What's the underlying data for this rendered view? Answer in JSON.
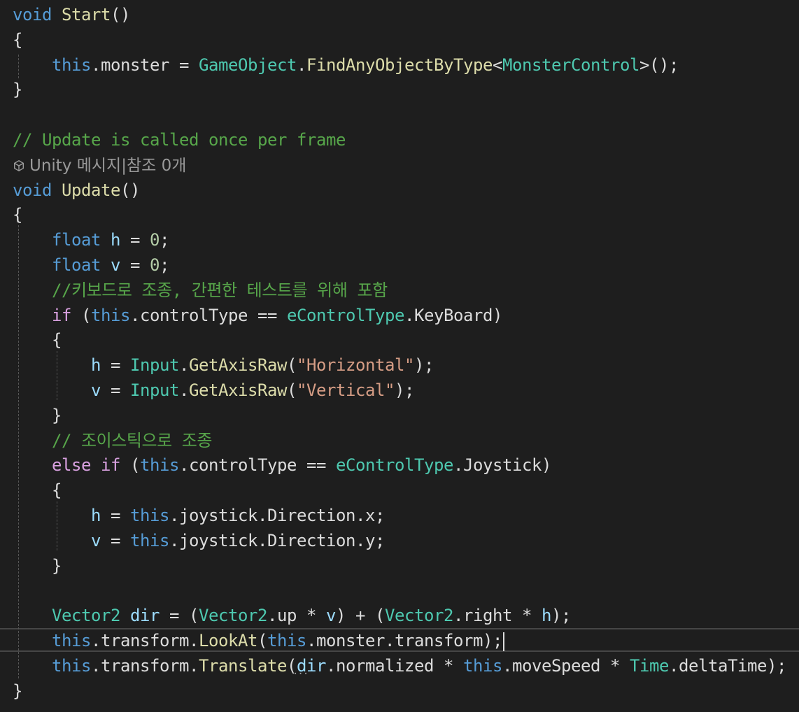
{
  "colors": {
    "background": "#1e1e1e",
    "keyword": "#569cd6",
    "control_keyword": "#d8a0df",
    "method": "#dcdcaa",
    "type": "#4ec9b0",
    "comment": "#57a64a",
    "string": "#d69d85",
    "number": "#b5cea8",
    "local": "#9cdcfe",
    "default": "#dcdcdc",
    "codelens": "#999999"
  },
  "editor": {
    "codelens_icon": "unity-cube-icon",
    "lines": [
      [
        {
          "t": "void",
          "c": "keyword"
        },
        {
          "t": " ",
          "c": "default"
        },
        {
          "t": "Start",
          "c": "method"
        },
        {
          "t": "()",
          "c": "default"
        }
      ],
      [
        {
          "t": "{",
          "c": "default"
        }
      ],
      [
        {
          "t": "    ",
          "c": "default"
        },
        {
          "t": "this",
          "c": "keyword"
        },
        {
          "t": ".monster = ",
          "c": "default"
        },
        {
          "t": "GameObject",
          "c": "type"
        },
        {
          "t": ".",
          "c": "default"
        },
        {
          "t": "FindAnyObjectByType",
          "c": "method"
        },
        {
          "t": "<",
          "c": "default"
        },
        {
          "t": "MonsterControl",
          "c": "type"
        },
        {
          "t": ">();",
          "c": "default"
        }
      ],
      [
        {
          "t": "}",
          "c": "default"
        }
      ],
      [],
      [
        {
          "t": "// Update is called once per frame",
          "c": "comment"
        }
      ],
      [
        {
          "t": "Unity 메시지|참조 0개",
          "c": "codelens"
        }
      ],
      [
        {
          "t": "void",
          "c": "keyword"
        },
        {
          "t": " ",
          "c": "default"
        },
        {
          "t": "Update",
          "c": "method"
        },
        {
          "t": "()",
          "c": "default"
        }
      ],
      [
        {
          "t": "{",
          "c": "default"
        }
      ],
      [
        {
          "t": "    ",
          "c": "default"
        },
        {
          "t": "float",
          "c": "keyword"
        },
        {
          "t": " ",
          "c": "default"
        },
        {
          "t": "h",
          "c": "local"
        },
        {
          "t": " = ",
          "c": "default"
        },
        {
          "t": "0",
          "c": "number"
        },
        {
          "t": ";",
          "c": "default"
        }
      ],
      [
        {
          "t": "    ",
          "c": "default"
        },
        {
          "t": "float",
          "c": "keyword"
        },
        {
          "t": " ",
          "c": "default"
        },
        {
          "t": "v",
          "c": "local"
        },
        {
          "t": " = ",
          "c": "default"
        },
        {
          "t": "0",
          "c": "number"
        },
        {
          "t": ";",
          "c": "default"
        }
      ],
      [
        {
          "t": "    ",
          "c": "default"
        },
        {
          "t": "//키보드로 조종, 간편한 테스트를 위해 포함",
          "c": "comment"
        }
      ],
      [
        {
          "t": "    ",
          "c": "default"
        },
        {
          "t": "if",
          "c": "control_keyword"
        },
        {
          "t": " (",
          "c": "default"
        },
        {
          "t": "this",
          "c": "keyword"
        },
        {
          "t": ".controlType == ",
          "c": "default"
        },
        {
          "t": "eControlType",
          "c": "type"
        },
        {
          "t": ".KeyBoard)",
          "c": "default"
        }
      ],
      [
        {
          "t": "    {",
          "c": "default"
        }
      ],
      [
        {
          "t": "        ",
          "c": "default"
        },
        {
          "t": "h",
          "c": "local"
        },
        {
          "t": " = ",
          "c": "default"
        },
        {
          "t": "Input",
          "c": "type"
        },
        {
          "t": ".",
          "c": "default"
        },
        {
          "t": "GetAxisRaw",
          "c": "method"
        },
        {
          "t": "(",
          "c": "default"
        },
        {
          "t": "\"Horizontal\"",
          "c": "string"
        },
        {
          "t": ");",
          "c": "default"
        }
      ],
      [
        {
          "t": "        ",
          "c": "default"
        },
        {
          "t": "v",
          "c": "local"
        },
        {
          "t": " = ",
          "c": "default"
        },
        {
          "t": "Input",
          "c": "type"
        },
        {
          "t": ".",
          "c": "default"
        },
        {
          "t": "GetAxisRaw",
          "c": "method"
        },
        {
          "t": "(",
          "c": "default"
        },
        {
          "t": "\"Vertical\"",
          "c": "string"
        },
        {
          "t": ");",
          "c": "default"
        }
      ],
      [
        {
          "t": "    }",
          "c": "default"
        }
      ],
      [
        {
          "t": "    ",
          "c": "default"
        },
        {
          "t": "// 조이스틱으로 조종",
          "c": "comment"
        }
      ],
      [
        {
          "t": "    ",
          "c": "default"
        },
        {
          "t": "else",
          "c": "control_keyword"
        },
        {
          "t": " ",
          "c": "default"
        },
        {
          "t": "if",
          "c": "control_keyword"
        },
        {
          "t": " (",
          "c": "default"
        },
        {
          "t": "this",
          "c": "keyword"
        },
        {
          "t": ".controlType == ",
          "c": "default"
        },
        {
          "t": "eControlType",
          "c": "type"
        },
        {
          "t": ".Joystick)",
          "c": "default"
        }
      ],
      [
        {
          "t": "    {",
          "c": "default"
        }
      ],
      [
        {
          "t": "        ",
          "c": "default"
        },
        {
          "t": "h",
          "c": "local"
        },
        {
          "t": " = ",
          "c": "default"
        },
        {
          "t": "this",
          "c": "keyword"
        },
        {
          "t": ".joystick.Direction.x;",
          "c": "default"
        }
      ],
      [
        {
          "t": "        ",
          "c": "default"
        },
        {
          "t": "v",
          "c": "local"
        },
        {
          "t": " = ",
          "c": "default"
        },
        {
          "t": "this",
          "c": "keyword"
        },
        {
          "t": ".joystick.Direction.y;",
          "c": "default"
        }
      ],
      [
        {
          "t": "    }",
          "c": "default"
        }
      ],
      [],
      [
        {
          "t": "    ",
          "c": "default"
        },
        {
          "t": "Vector2",
          "c": "type"
        },
        {
          "t": " ",
          "c": "default"
        },
        {
          "t": "dir",
          "c": "local"
        },
        {
          "t": " = (",
          "c": "default"
        },
        {
          "t": "Vector2",
          "c": "type"
        },
        {
          "t": ".up * ",
          "c": "default"
        },
        {
          "t": "v",
          "c": "local"
        },
        {
          "t": ") + (",
          "c": "default"
        },
        {
          "t": "Vector2",
          "c": "type"
        },
        {
          "t": ".right * ",
          "c": "default"
        },
        {
          "t": "h",
          "c": "local"
        },
        {
          "t": ");",
          "c": "default"
        }
      ],
      [
        {
          "t": "    ",
          "c": "default"
        },
        {
          "t": "this",
          "c": "keyword"
        },
        {
          "t": ".transform.",
          "c": "default"
        },
        {
          "t": "LookAt",
          "c": "method"
        },
        {
          "t": "(",
          "c": "default"
        },
        {
          "t": "this",
          "c": "keyword"
        },
        {
          "t": ".monster.transform);",
          "c": "default"
        }
      ],
      [
        {
          "t": "    ",
          "c": "default"
        },
        {
          "t": "this",
          "c": "keyword"
        },
        {
          "t": ".transform.",
          "c": "default"
        },
        {
          "t": "Translate",
          "c": "method"
        },
        {
          "t": "(",
          "c": "default"
        },
        {
          "t": "dir",
          "c": "local"
        },
        {
          "t": ".normalized * ",
          "c": "default"
        },
        {
          "t": "this",
          "c": "keyword"
        },
        {
          "t": ".moveSpeed * ",
          "c": "default"
        },
        {
          "t": "Time",
          "c": "type"
        },
        {
          "t": ".deltaTime);",
          "c": "default"
        }
      ],
      [
        {
          "t": "}",
          "c": "default"
        }
      ]
    ]
  }
}
